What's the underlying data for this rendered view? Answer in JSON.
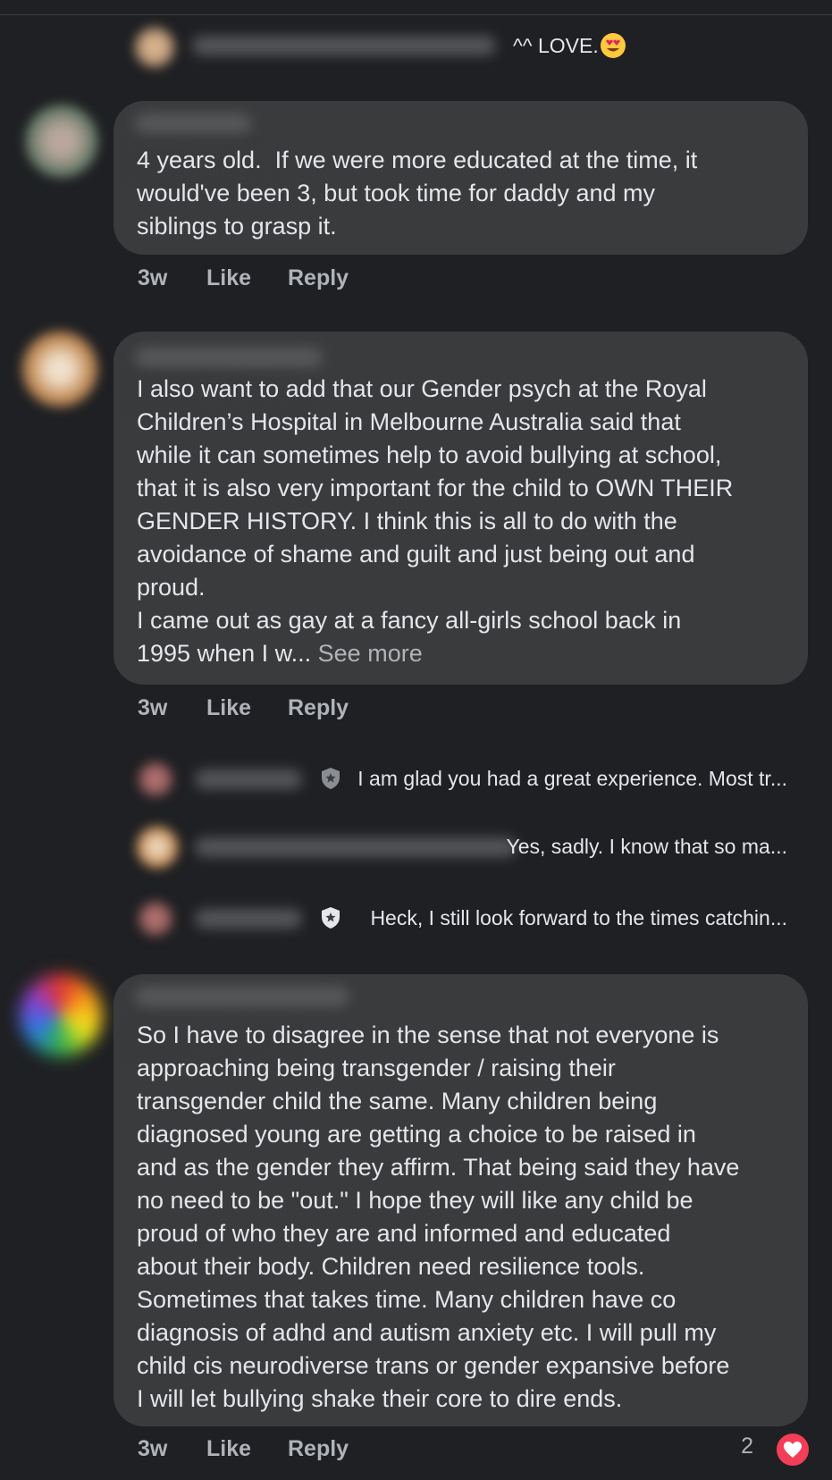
{
  "top_reply": {
    "text": "^^ LOVE.",
    "emoji": "smiling-face-with-heart-eyes"
  },
  "comments": [
    {
      "text": "4 years old.  If we were more educated at the time, it\nwould've been 3, but took time for daddy and my\nsiblings to grasp it.",
      "time": "3w",
      "like": "Like",
      "reply": "Reply"
    },
    {
      "text": "I also want to add that our Gender psych at the Royal\nChildren’s Hospital in Melbourne Australia said that\nwhile it can sometimes help to avoid bullying at school,\nthat it is also very important for the child to OWN THEIR\nGENDER HISTORY. I think this is all to do with the\navoidance of shame and guilt and just being out and\nproud.\nI came out as gay at a fancy all-girls school back in\n1995 when I w...",
      "see_more": "See more",
      "time": "3w",
      "like": "Like",
      "reply": "Reply",
      "replies": [
        {
          "text": "I am glad you had a great experience. Most tr...",
          "badge": "shield-icon"
        },
        {
          "text": "Yes, sadly. I know that so ma...",
          "badge": ""
        },
        {
          "text": "Heck, I still look forward to the times catchin...",
          "badge": "shield-icon"
        }
      ]
    },
    {
      "text": "So I have to disagree in the sense that not everyone is\napproaching being transgender / raising their\ntransgender child the same. Many children being\ndiagnosed young are getting a choice to be raised in\nand as the gender they affirm. That being said they have\nno need to be \"out.\" I hope they will like any child be\nproud of who they are and informed and educated\nabout their body. Children need resilience tools.\nSometimes that takes time. Many children have co\ndiagnosis of adhd and autism anxiety etc. I will pull my\nchild cis neurodiverse trans or gender expansive before\nI will let bullying shake their core to dire ends.",
      "time": "3w",
      "like": "Like",
      "reply": "Reply",
      "reaction_count": "2",
      "reaction_icon": "heart-icon"
    }
  ],
  "colors": {
    "background": "#1f2023",
    "bubble": "#3a3b3c",
    "text": "#e4e6eb",
    "secondary": "#b0b3b8",
    "heart": "#f33e58"
  }
}
